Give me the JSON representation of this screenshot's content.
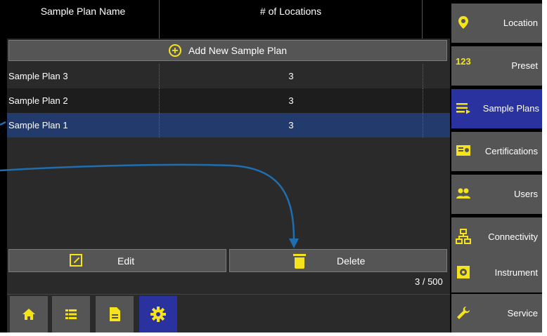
{
  "table": {
    "header_name": "Sample Plan Name",
    "header_count": "# of Locations",
    "add_label": "Add New Sample Plan",
    "rows": [
      {
        "name": "Sample Plan 3",
        "count": "3"
      },
      {
        "name": "Sample Plan 2",
        "count": "3"
      },
      {
        "name": "Sample Plan 1",
        "count": "3"
      }
    ]
  },
  "actions": {
    "edit_label": "Edit",
    "delete_label": "Delete"
  },
  "counter": "3 / 500",
  "sidebar": {
    "items": [
      {
        "label": "Location",
        "icon": "location-pin-icon"
      },
      {
        "label": "Preset",
        "icon": "numbers-123-icon"
      },
      {
        "label": "Sample Plans",
        "icon": "list-arrow-icon"
      },
      {
        "label": "Certifications",
        "icon": "certificate-icon"
      },
      {
        "label": "Users",
        "icon": "users-icon"
      },
      {
        "label": "Connectivity",
        "icon": "network-icon"
      },
      {
        "label": "Instrument",
        "icon": "instrument-icon"
      },
      {
        "label": "Service",
        "icon": "wrench-icon"
      }
    ],
    "active": "Sample Plans"
  },
  "bottom_nav": {
    "items": [
      "home-icon",
      "list-icon",
      "document-icon",
      "gear-icon"
    ],
    "active": "gear-icon"
  },
  "colors": {
    "accent_yellow": "#f5e31c",
    "active_blue": "#2a32a0",
    "selected_row": "#233a6c",
    "callout_arrow": "#1f6fb0"
  }
}
